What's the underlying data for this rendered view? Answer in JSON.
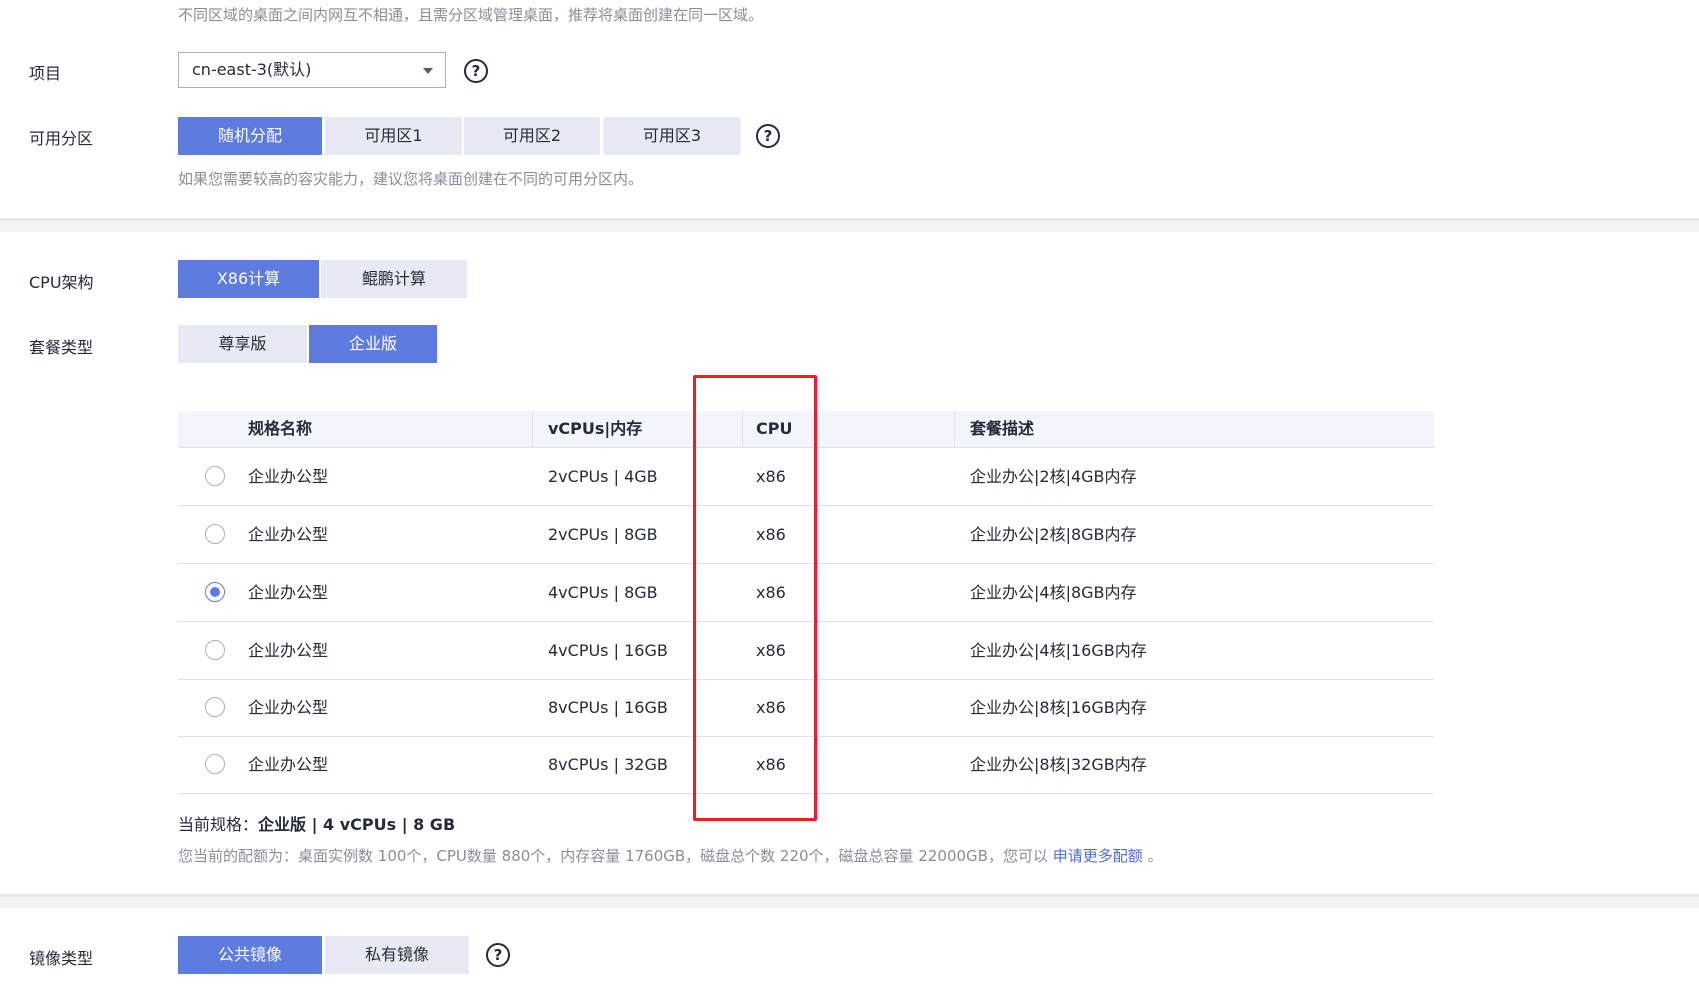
{
  "region_hint": "不同区域的桌面之间内网互不相通，且需分区域管理桌面，推荐将桌面创建在同一区域。",
  "project": {
    "label": "项目",
    "value": "cn-east-3(默认)"
  },
  "zone": {
    "label": "可用分区",
    "options": [
      "随机分配",
      "可用区1",
      "可用区2",
      "可用区3"
    ],
    "selected": "随机分配",
    "hint": "如果您需要较高的容灾能力，建议您将桌面创建在不同的可用分区内。"
  },
  "cpu_arch": {
    "label": "CPU架构",
    "options": [
      "X86计算",
      "鲲鹏计算"
    ],
    "selected": "X86计算"
  },
  "package_type": {
    "label": "套餐类型",
    "options": [
      "尊享版",
      "企业版"
    ],
    "selected": "企业版"
  },
  "table": {
    "headers": [
      "规格名称",
      "vCPUs|内存",
      "CPU",
      "套餐描述"
    ],
    "rows": [
      {
        "name": "企业办公型",
        "spec": "2vCPUs | 4GB",
        "cpu": "x86",
        "desc": "企业办公|2核|4GB内存",
        "selected": false
      },
      {
        "name": "企业办公型",
        "spec": "2vCPUs | 8GB",
        "cpu": "x86",
        "desc": "企业办公|2核|8GB内存",
        "selected": false
      },
      {
        "name": "企业办公型",
        "spec": "4vCPUs | 8GB",
        "cpu": "x86",
        "desc": "企业办公|4核|8GB内存",
        "selected": true
      },
      {
        "name": "企业办公型",
        "spec": "4vCPUs | 16GB",
        "cpu": "x86",
        "desc": "企业办公|4核|16GB内存",
        "selected": false
      },
      {
        "name": "企业办公型",
        "spec": "8vCPUs | 16GB",
        "cpu": "x86",
        "desc": "企业办公|8核|16GB内存",
        "selected": false
      },
      {
        "name": "企业办公型",
        "spec": "8vCPUs | 32GB",
        "cpu": "x86",
        "desc": "企业办公|8核|32GB内存",
        "selected": false
      }
    ]
  },
  "current_spec": {
    "label": "当前规格：",
    "value": "企业版 | 4 vCPUs | 8 GB"
  },
  "quota": {
    "text": "您当前的配额为：桌面实例数 100个，CPU数量 880个，内存容量 1760GB，磁盘总个数 220个，磁盘总容量 22000GB，您可以",
    "link": "申请更多配额",
    "suffix": "。"
  },
  "image_type": {
    "label": "镜像类型",
    "options": [
      "公共镜像",
      "私有镜像"
    ],
    "selected": "公共镜像"
  },
  "help_glyph": "?",
  "colors": {
    "primary": "#5e7ce0",
    "highlight_box": "#e9202c",
    "segment_bg": "#e7eaf2"
  }
}
